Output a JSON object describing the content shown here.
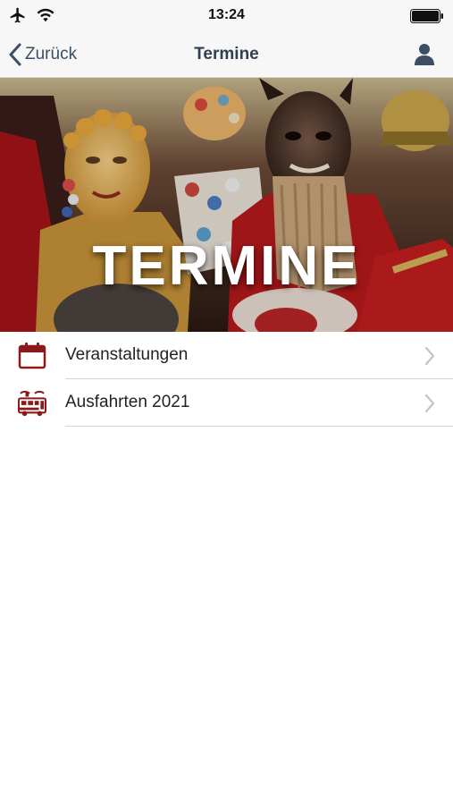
{
  "status_bar": {
    "time": "13:24"
  },
  "nav": {
    "back_label": "Zurück",
    "title": "Termine"
  },
  "hero": {
    "title": "TERMINE"
  },
  "menu": {
    "items": [
      {
        "label": "Veranstaltungen",
        "icon": "calendar-icon"
      },
      {
        "label": "Ausfahrten 2021",
        "icon": "bus-icon"
      }
    ]
  },
  "colors": {
    "accent": "#8b1a1a",
    "nav_text": "#3a4e66"
  }
}
